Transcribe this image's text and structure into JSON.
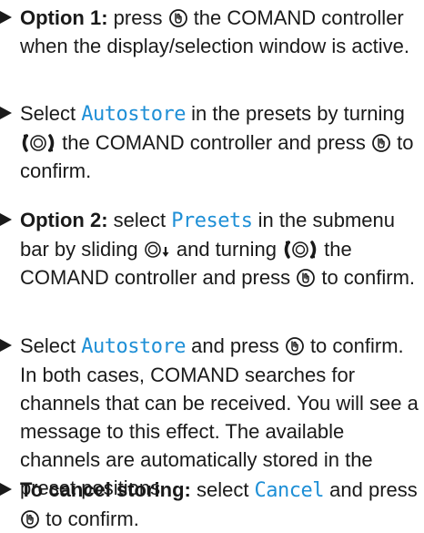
{
  "colors": {
    "text": "#1a1a1a",
    "highlight": "#1e8fd6"
  },
  "icons": {
    "press": "press-controller-icon",
    "turn": "turn-controller-icon",
    "slide": "slide-down-controller-icon",
    "bullet": "triangle-bullet-icon"
  },
  "steps": [
    {
      "label": "Option 1:",
      "t1": " press ",
      "t2": " the COMAND controller when the display/selection window is active."
    },
    {
      "t1": "Select ",
      "menu": "Autostore",
      "t2": " in the presets by turning ",
      "t3": " the COMAND controller and press ",
      "t4": " to confirm."
    },
    {
      "label": "Option 2:",
      "t1": " select ",
      "menu": "Presets",
      "t2": " in the submenu bar by sliding ",
      "t3": " and turning ",
      "t4": " the COMAND controller and press ",
      "t5": " to confirm."
    },
    {
      "t1": "Select ",
      "menu": "Autostore",
      "t2": " and press ",
      "t3": " to confirm.",
      "result": "In both cases, COMAND searches for channels that can be received. You will see a message to this effect. The available channels are automatically stored in the preset positions."
    },
    {
      "label": "To cancel storing:",
      "t1": " select ",
      "menu": "Cancel",
      "t2": " and press ",
      "t3": " to confirm."
    }
  ]
}
